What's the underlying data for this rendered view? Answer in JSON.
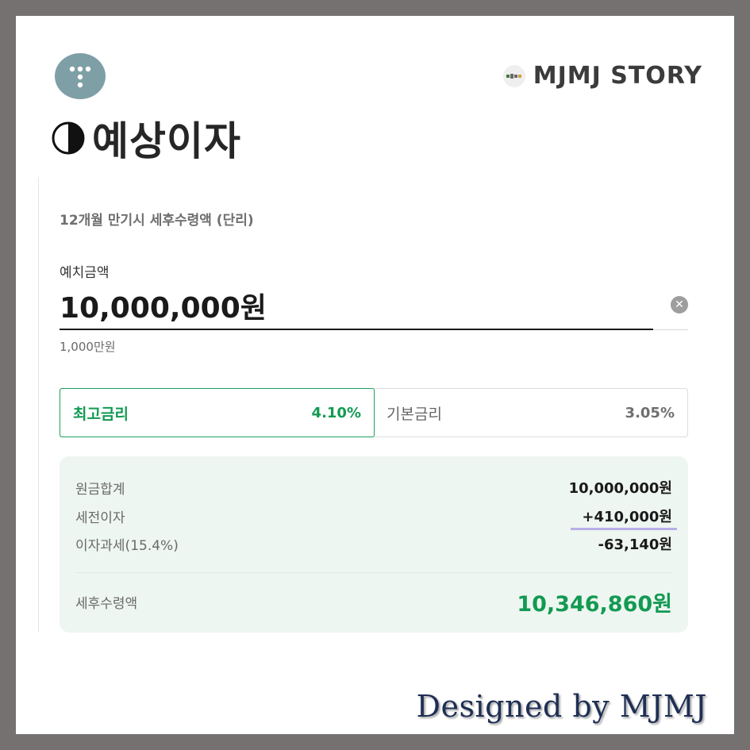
{
  "brand": {
    "name": "MJMJ STORY"
  },
  "page_title": {
    "icon": "half-circle-icon",
    "text": "예상이자"
  },
  "calculator": {
    "subtitle": "12개월 만기시 세후수령액 (단리)",
    "deposit_label": "예치금액",
    "deposit_value": "10,000,000원",
    "deposit_hint": "1,000만원",
    "clear_icon": "close-icon",
    "rate_tabs": [
      {
        "label": "최고금리",
        "rate": "4.10%",
        "selected": true
      },
      {
        "label": "기본금리",
        "rate": "3.05%",
        "selected": false
      }
    ],
    "summary": {
      "principal_label": "원금합계",
      "principal_value": "10,000,000원",
      "pretax_interest_label": "세전이자",
      "pretax_interest_value": "+410,000원",
      "tax_label": "이자과세(15.4%)",
      "tax_value": "-63,140원",
      "net_label": "세후수령액",
      "net_value": "10,346,860원"
    }
  },
  "footer": {
    "signature": "Designed by MJMJ"
  },
  "colors": {
    "accent_green": "#129a52",
    "summary_bg": "#eef6f1",
    "frame": "#757171",
    "logo_bg": "#7e9fa6"
  }
}
